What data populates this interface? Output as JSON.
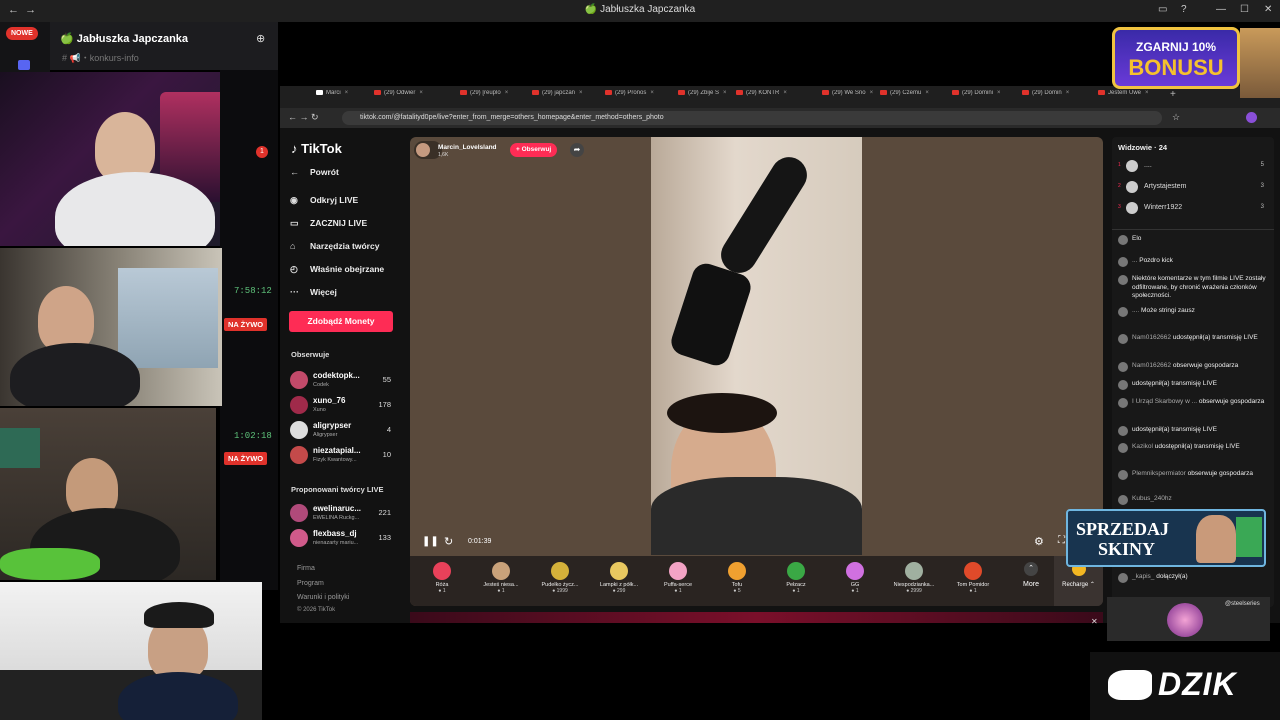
{
  "window": {
    "title": "🍏 Jabłuszka Japczanka"
  },
  "discord": {
    "badge": "NOWE",
    "server_name": "🍏 Jabłuszka Japczanka",
    "channel": "# 📢・konkurs-info",
    "notif": "1"
  },
  "streams": [
    {
      "timer": "7:58:12",
      "live": "NA ŻYWO"
    },
    {
      "timer": "1:02:18",
      "live": "NA ŻYWO"
    }
  ],
  "browser": {
    "tabs": [
      "Marci",
      "(29) Odwier",
      "(29) [reuplo",
      "(29) japczan",
      "(29) Pronos",
      "(29) Zbije S",
      "(29) KONTR",
      "(29) We Sno",
      "(29) Czemu",
      "(29) Domini",
      "(29) Domin",
      "Jestem Uwe"
    ],
    "url": "tiktok.com/@fatalityd0pe/live?enter_from_merge=others_homepage&enter_method=others_photo"
  },
  "tiktok": {
    "logo": "TikTok",
    "back": "Powrót",
    "nav": [
      "Odkryj LIVE",
      "ZACZNIJ LIVE",
      "Narzędzia twórcy",
      "Właśnie obejrzane",
      "Więcej"
    ],
    "coins_button": "Zdobądź Monety",
    "following_title": "Obserwuje",
    "following": [
      {
        "name": "codektopk...",
        "sub": "Codek",
        "count": "55"
      },
      {
        "name": "xuno_76",
        "sub": "Xuno",
        "count": "178"
      },
      {
        "name": "aligrypser",
        "sub": "Aligrypser",
        "count": "4"
      },
      {
        "name": "niezatapial...",
        "sub": "Fizyk Kwantowy...",
        "count": "10"
      }
    ],
    "suggested_title": "Proponowani twórcy LIVE",
    "suggested": [
      {
        "name": "ewelinaruc...",
        "sub": "EWELINA Ruckg...",
        "count": "221"
      },
      {
        "name": "flexbass_dj",
        "sub": "nienazarty mariu...",
        "count": "133"
      }
    ],
    "footer": [
      "Firma",
      "Program",
      "Warunki i polityki",
      "© 2026 TikTok"
    ]
  },
  "player": {
    "host": "Marcin_Lovelsland",
    "likes": "1,6K",
    "follow": "+ Obserwuj",
    "time": "0:01:39",
    "gifts": [
      {
        "name": "Róża",
        "price": "1",
        "color": "#e8415a"
      },
      {
        "name": "Jesteś niesa...",
        "price": "1",
        "color": "#c9a27a"
      },
      {
        "name": "Pudełko życz...",
        "price": "1999",
        "color": "#d4b13a"
      },
      {
        "name": "Lampki z półk...",
        "price": "299",
        "color": "#e8c860"
      },
      {
        "name": "Puffa-serce",
        "price": "1",
        "color": "#f3a3c5"
      },
      {
        "name": "Tofu",
        "price": "5",
        "color": "#f0a030"
      },
      {
        "name": "Pełzacz",
        "price": "1",
        "color": "#3aa845"
      },
      {
        "name": "GG",
        "price": "1",
        "color": "#d070e0"
      },
      {
        "name": "Niespodzianka...",
        "price": "2999",
        "color": "#a0b0a0"
      },
      {
        "name": "Tom Pomidor",
        "price": "1",
        "color": "#e04a2a"
      }
    ],
    "more": "More",
    "recharge": "Recharge ⌃"
  },
  "chat": {
    "title": "Widzowie · 24",
    "viewers": [
      {
        "rank": "1",
        "name": "....",
        "score": "5"
      },
      {
        "rank": "2",
        "name": "Artystajestem",
        "score": "3"
      },
      {
        "rank": "3",
        "name": "Winterr1922",
        "score": "3"
      }
    ],
    "messages": [
      {
        "user": "",
        "text": "Elo"
      },
      {
        "user": "...",
        "text": "Pozdro kick"
      },
      {
        "user": "",
        "text": "Niektóre komentarze w tym filmie LIVE zostały odfiltrowane, by chronić wrażenia członków społeczności."
      },
      {
        "user": "....",
        "text": "Może stringi zausz"
      },
      {
        "user": "Nam0162662",
        "text": "udostępnił(a) transmisję LIVE"
      },
      {
        "user": "Nam0162662",
        "text": "obserwuje gospodarza"
      },
      {
        "user": "",
        "text": "udostępnił(a) transmisję LIVE"
      },
      {
        "user": "I Urząd Skarbowy w ...",
        "text": "obserwuje gospodarza"
      },
      {
        "user": "",
        "text": "udostępnił(a) transmisję LIVE"
      },
      {
        "user": "Kazikol",
        "text": "udostępnił(a) transmisję LIVE"
      },
      {
        "user": "Plemnikspermiator",
        "text": "obserwuje gospodarza"
      },
      {
        "user": "Kubus_240hz",
        "text": ""
      },
      {
        "user": "_kapis_",
        "text": "dołączył(a)"
      }
    ]
  },
  "overlays": {
    "bonus_l1": "ZGARNIJ 10%",
    "bonus_l2": "BONUSU",
    "skiny_l1": "SPRZEDAJ",
    "skiny_l2": "SKINY",
    "dzik": "DZIK",
    "steel": "@steelseries"
  }
}
